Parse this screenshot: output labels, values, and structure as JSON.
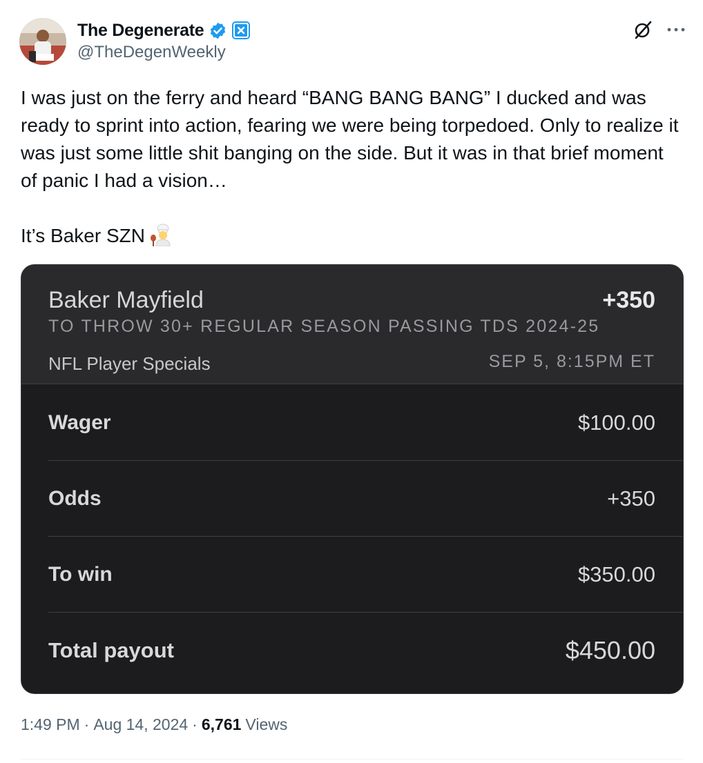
{
  "author": {
    "display_name": "The Degenerate",
    "handle": "@TheDegenWeekly",
    "verified_color": "#1d9bf0",
    "affiliate_badge_color": "#1d9bf0"
  },
  "tweet": {
    "paragraph_1": "I was just on the ferry and heard “BANG BANG BANG” I ducked and was ready to sprint into action, fearing we were being torpedoed. Only to realize it was just some little shit banging on the side. But it was in that brief moment of panic I had a vision…",
    "paragraph_2": "It’s Baker SZN",
    "emoji": "cook-emoji"
  },
  "bet": {
    "player": "Baker Mayfield",
    "odds_header": "+350",
    "market": "TO THROW 30+ REGULAR SEASON PASSING TDS 2024-25",
    "league": "NFL Player Specials",
    "event_time": "SEP 5, 8:15PM ET",
    "rows": [
      {
        "label": "Wager",
        "value": "$100.00"
      },
      {
        "label": "Odds",
        "value": "+350"
      },
      {
        "label": "To win",
        "value": "$350.00"
      },
      {
        "label": "Total payout",
        "value": "$450.00"
      }
    ]
  },
  "meta": {
    "time": "1:49 PM",
    "separator_1": "·",
    "date": "Aug 14, 2024",
    "separator_2": "·",
    "views_count": "6,761",
    "views_label": "Views"
  }
}
